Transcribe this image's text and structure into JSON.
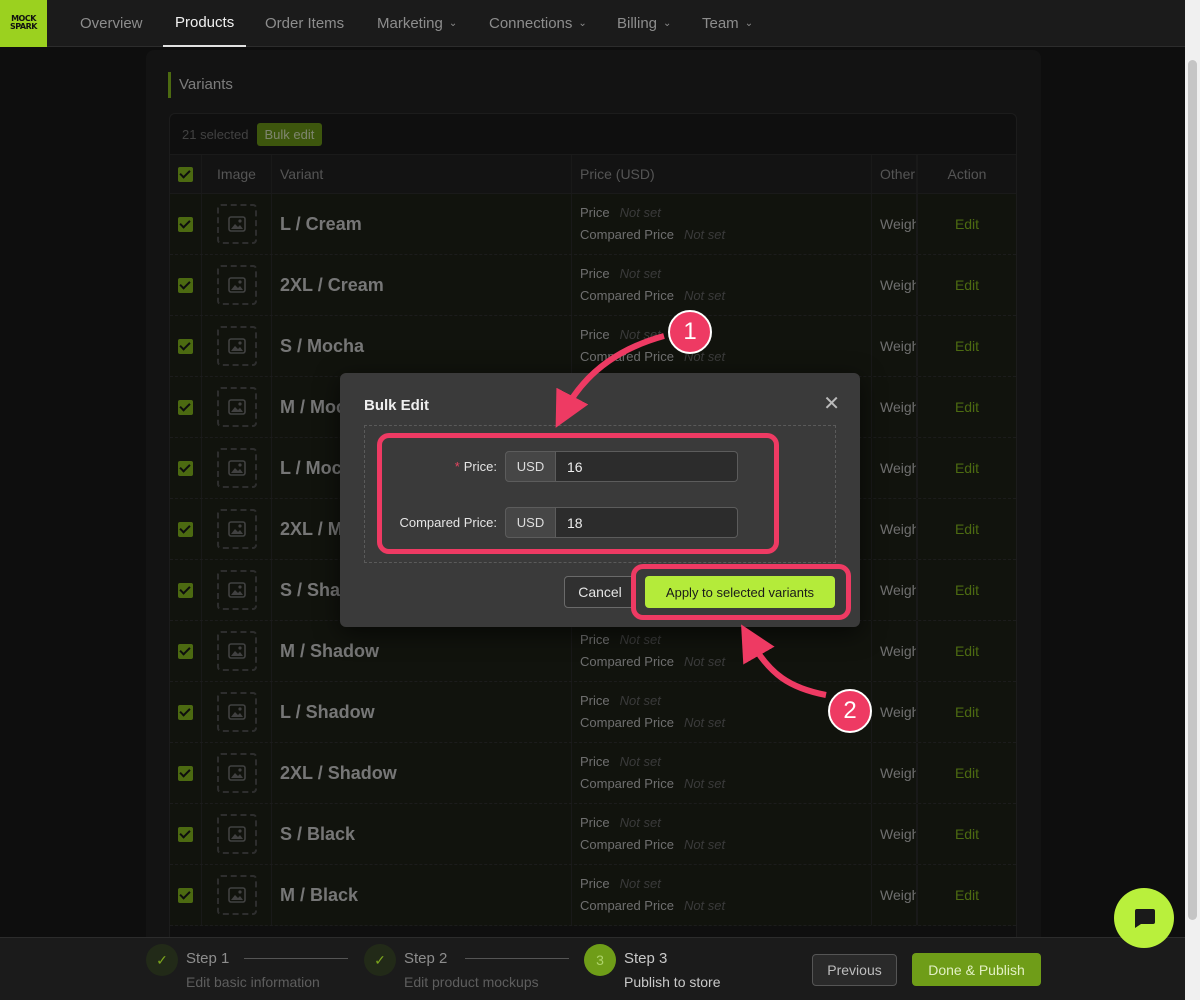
{
  "nav": {
    "logo_line1": "MOCK",
    "logo_line2": "SPARK",
    "items": [
      {
        "label": "Overview"
      },
      {
        "label": "Products"
      },
      {
        "label": "Order Items"
      },
      {
        "label": "Marketing"
      },
      {
        "label": "Connections"
      },
      {
        "label": "Billing"
      },
      {
        "label": "Team"
      }
    ],
    "active": "Products"
  },
  "section": {
    "title": "Variants",
    "selected_text": "21 selected",
    "bulk_edit_label": "Bulk edit"
  },
  "table": {
    "headers": {
      "image": "Image",
      "variant": "Variant",
      "price": "Price (USD)",
      "other": "Other",
      "action": "Action"
    },
    "price_label": "Price",
    "compared_label": "Compared Price",
    "not_set": "Not set",
    "weight_text": "Weigh",
    "edit_label": "Edit",
    "rows": [
      {
        "variant": "L / Cream"
      },
      {
        "variant": "2XL / Cream"
      },
      {
        "variant": "S / Mocha"
      },
      {
        "variant": "M / Mocha"
      },
      {
        "variant": "L / Mocha"
      },
      {
        "variant": "2XL / Mocha"
      },
      {
        "variant": "S / Shadow"
      },
      {
        "variant": "M / Shadow"
      },
      {
        "variant": "L / Shadow"
      },
      {
        "variant": "2XL / Shadow"
      },
      {
        "variant": "S / Black"
      },
      {
        "variant": "M / Black"
      }
    ]
  },
  "modal": {
    "title": "Bulk Edit",
    "price_label": "Price:",
    "price_required_mark": "*",
    "compared_label": "Compared Price:",
    "currency": "USD",
    "price_value": "16",
    "compared_value": "18",
    "cancel_label": "Cancel",
    "apply_label": "Apply to selected variants"
  },
  "annotations": {
    "badge1": "1",
    "badge2": "2",
    "highlight_color": "#ee3a63"
  },
  "footer": {
    "steps": [
      {
        "title": "Step 1",
        "desc": "Edit basic information",
        "status": "done"
      },
      {
        "title": "Step 2",
        "desc": "Edit product mockups",
        "status": "done"
      },
      {
        "title": "Step 3",
        "desc": "Publish to store",
        "status": "current",
        "number": "3"
      }
    ],
    "previous_label": "Previous",
    "done_label": "Done & Publish"
  },
  "colors": {
    "accent": "#8bc21f",
    "accent_bright": "#b4eb3a",
    "background": "#1a1a1a"
  }
}
